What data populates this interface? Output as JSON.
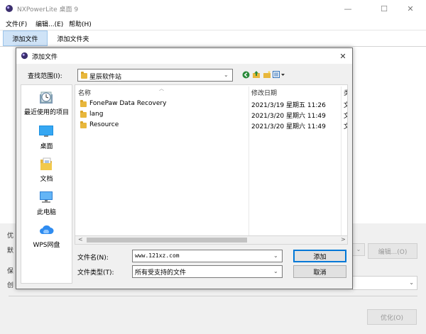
{
  "app": {
    "title": "NXPowerLite 桌面 9",
    "window_controls": {
      "minimize": "—",
      "maximize": "☐",
      "close": "✕"
    }
  },
  "menubar": [
    "文件(F)",
    "编辑...(E)",
    "帮助(H)"
  ],
  "toolbar": {
    "add_file": "添加文件",
    "add_folder": "添加文件夹"
  },
  "background": {
    "optimize_label_fragment": "优",
    "default_fragment": "默",
    "save_label_fragment": "保",
    "create_fragment": "创",
    "edit_button": "编辑...(O)",
    "optimize_button": "优化(O)"
  },
  "dialog": {
    "title": "添加文件",
    "close": "✕",
    "look_in_label": "查找范围(I):",
    "look_in_value": "星辰软件站",
    "places": [
      {
        "label": "最近使用的项目",
        "icon": "recent-items-icon"
      },
      {
        "label": "桌面",
        "icon": "desktop-icon"
      },
      {
        "label": "文档",
        "icon": "documents-icon"
      },
      {
        "label": "此电脑",
        "icon": "this-pc-icon"
      },
      {
        "label": "WPS网盘",
        "icon": "wps-cloud-icon"
      }
    ],
    "columns": {
      "name": "名称",
      "modified": "修改日期",
      "type_fragment": "类"
    },
    "files": [
      {
        "name": "FonePaw Data Recovery",
        "modified": "2021/3/19 星期五 11:26",
        "type_fragment": "文"
      },
      {
        "name": "lang",
        "modified": "2021/3/20 星期六 11:49",
        "type_fragment": "文"
      },
      {
        "name": "Resource",
        "modified": "2021/3/20 星期六 11:49",
        "type_fragment": "文"
      }
    ],
    "filename_label": "文件名(N):",
    "filename_value": "www.121xz.com",
    "filetype_label": "文件类型(T):",
    "filetype_value": "所有受支持的文件",
    "add_button": "添加",
    "cancel_button": "取消"
  },
  "colors": {
    "accent": "#0078d7",
    "folder": "#e8b73c",
    "toolbar_active": "#cfe3f7"
  }
}
